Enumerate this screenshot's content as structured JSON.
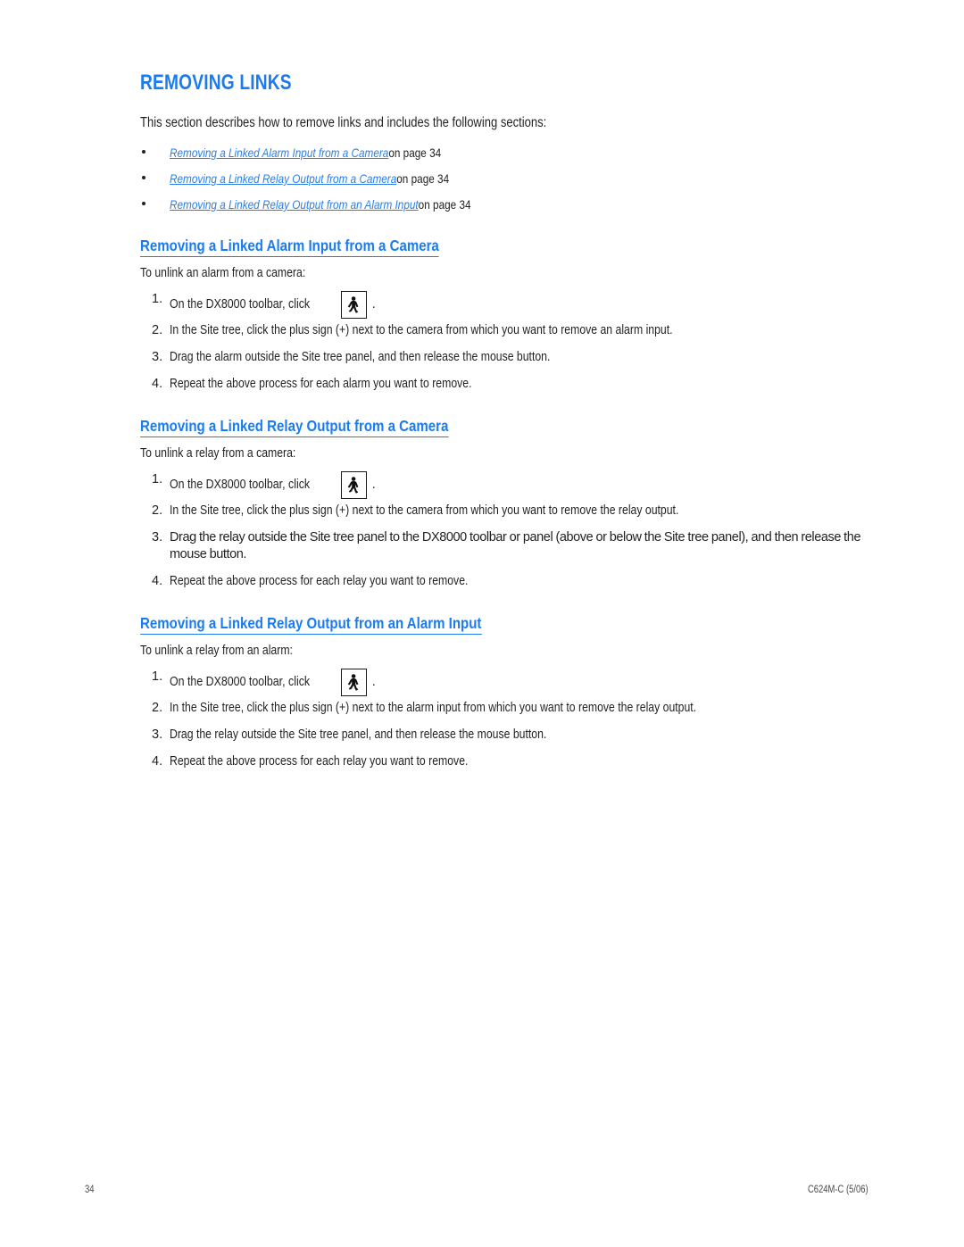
{
  "document": {
    "title": "REMOVING LINKS",
    "intro": "This section describes how to remove links and includes the following sections:",
    "accent_color": "#1a7cf0",
    "link_color": "#2a7fe8",
    "text_color": "#231f20"
  },
  "toc": {
    "items": [
      {
        "xref": "Removing a Linked Alarm Input from a Camera",
        "tail": "on page 34"
      },
      {
        "xref": "Removing a Linked Relay Output from a Camera",
        "tail": "on page 34"
      },
      {
        "xref": "Removing a Linked Relay Output from an Alarm Input",
        "tail": "on page 34"
      }
    ]
  },
  "sections": [
    {
      "heading": "Removing a Linked Alarm Input from a Camera",
      "intro": "To unlink an alarm from a camera:",
      "steps": [
        {
          "num": "1.",
          "lead": "On the DX8000 toolbar, click",
          "icon": "pedestrian-walking-icon",
          "trail": "."
        },
        {
          "num": "2.",
          "text": "In the Site tree, click the plus sign (+) next to the camera from which you want to remove an alarm input."
        },
        {
          "num": "3.",
          "text": "Drag the alarm outside the Site tree panel, and then release the mouse button."
        },
        {
          "num": "4.",
          "text": "Repeat the above process for each alarm you want to remove."
        }
      ]
    },
    {
      "heading": "Removing a Linked Relay Output from a Camera",
      "intro": "To unlink a relay from a camera:",
      "steps": [
        {
          "num": "1.",
          "lead": "On the DX8000 toolbar, click",
          "icon": "pedestrian-walking-icon",
          "trail": "."
        },
        {
          "num": "2.",
          "text": "In the Site tree, click the plus sign (+) next to the camera from which you want to remove the relay output."
        },
        {
          "num": "3.",
          "text": "Drag the relay outside the Site tree panel to the DX8000 toolbar or panel (above or below the Site tree panel), and then release the mouse button."
        },
        {
          "num": "4.",
          "text": "Repeat the above process for each relay you want to remove."
        }
      ]
    },
    {
      "heading": "Removing a Linked Relay Output from an Alarm Input",
      "intro": "To unlink a relay from an alarm:",
      "steps": [
        {
          "num": "1.",
          "lead": "On the DX8000 toolbar, click",
          "icon": "pedestrian-walking-icon",
          "trail": "."
        },
        {
          "num": "2.",
          "text": "In the Site tree, click the plus sign (+) next to the alarm input from which you want to remove the relay output."
        },
        {
          "num": "3.",
          "text": "Drag the relay outside the Site tree panel, and then release the mouse button."
        },
        {
          "num": "4.",
          "text": "Repeat the above process for each relay you want to remove."
        }
      ]
    }
  ],
  "footer": {
    "page_number": "34",
    "doc_code": "C624M-C (5/06)"
  }
}
